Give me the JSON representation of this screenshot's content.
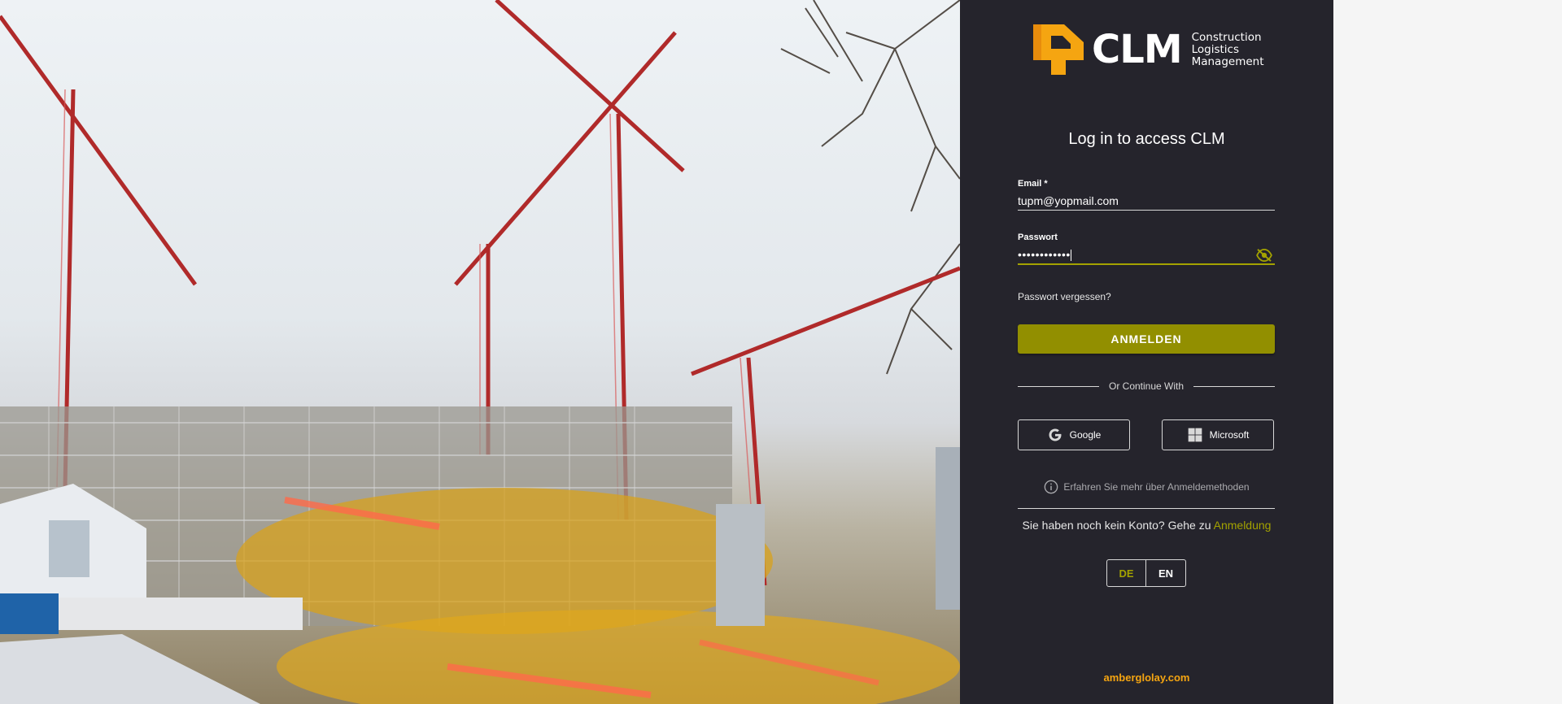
{
  "brand": {
    "name": "CLM",
    "tagline": [
      "Construction",
      "Logistics",
      "Management"
    ],
    "accent": "#a3a200",
    "logo_orange": "#f5a511",
    "panel_bg": "#25242c"
  },
  "login": {
    "title": "Log in to access CLM",
    "email": {
      "label": "Email *",
      "value": "tupm@yopmail.com"
    },
    "password": {
      "label": "Passwort",
      "value": "••••••••••••",
      "toggle_icon": "eye-off-icon"
    },
    "forgot": "Passwort vergessen?",
    "submit": "ANMELDEN",
    "divider": "Or Continue With",
    "google": "Google",
    "microsoft": "Microsoft",
    "info": "Erfahren Sie mehr über Anmeldemethoden",
    "signup_text": "Sie haben noch kein Konto? Gehe zu",
    "signup_link": "Anmeldung"
  },
  "language": {
    "options": [
      "DE",
      "EN"
    ],
    "selected": "DE"
  },
  "footer": {
    "link": "amberglolay.com"
  }
}
